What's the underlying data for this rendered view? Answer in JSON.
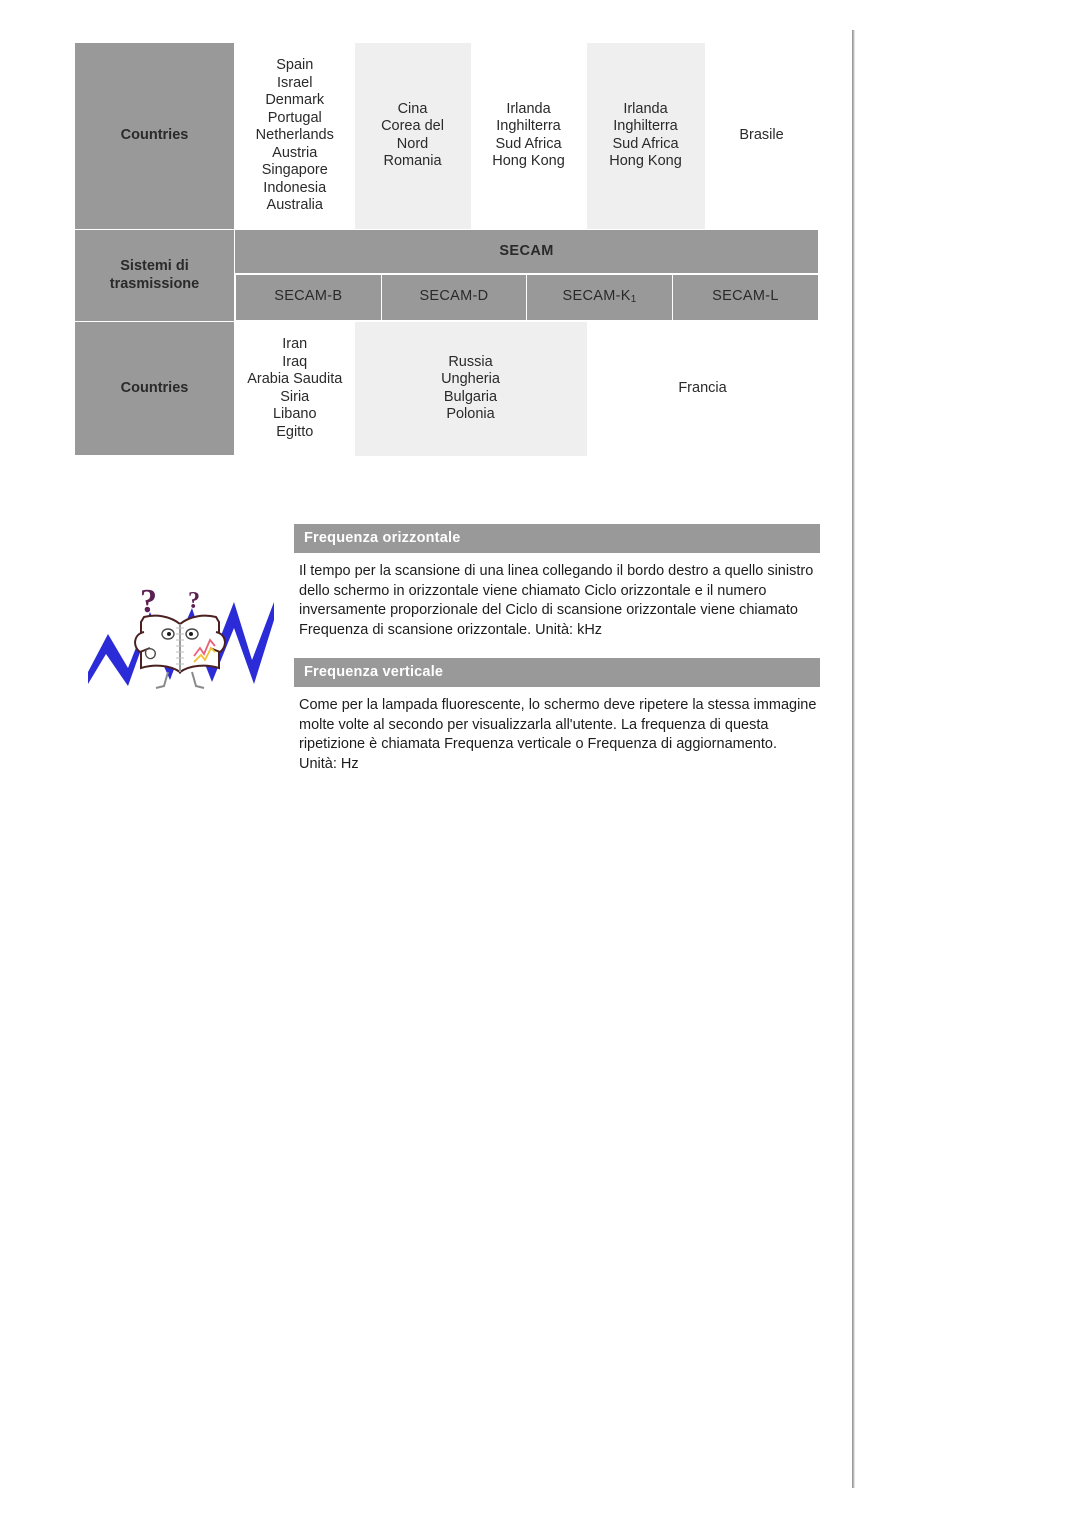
{
  "broadcast_table": {
    "row_countries_top": {
      "header": "Countries",
      "cells": [
        "Spain\nIsrael\nDenmark\nPortugal\nNetherlands\nAustria\nSingapore\nIndonesia\nAustralia",
        "Cina\nCorea del\nNord\nRomania",
        "Irlanda\nInghilterra\nSud Africa\nHong Kong",
        "Irlanda\nInghilterra\nSud Africa\nHong Kong",
        "Brasile"
      ]
    },
    "row_systems": {
      "header": "Sistemi di\ntrasmissione",
      "group_label": "SECAM",
      "systems": [
        {
          "label": "SECAM-B",
          "sub": ""
        },
        {
          "label": "SECAM-D",
          "sub": ""
        },
        {
          "label": "SECAM-K",
          "sub": "1"
        },
        {
          "label": "SECAM-L",
          "sub": ""
        }
      ]
    },
    "row_countries_bottom": {
      "header": "Countries",
      "cells": [
        "Iran\nIraq\nArabia Saudita\nSiria\nLibano\nEgitto",
        "Russia\nUngheria\nBulgaria\nPolonia",
        "Francia"
      ]
    }
  },
  "definitions": [
    {
      "title": "Frequenza orizzontale",
      "body": "Il tempo per la scansione di una linea collegando il bordo destro a quello sinistro dello schermo in orizzontale viene chiamato Ciclo orizzontale e il numero inversamente proporzionale del Ciclo di scansione orizzontale viene chiamato Frequenza di scansione orizzontale. Unità: kHz"
    },
    {
      "title": "Frequenza verticale",
      "body": "Come per la lampada fluorescente, lo schermo deve ripetere la stessa immagine molte volte al secondo per visualizzarla all'utente. La frequenza di questa ripetizione è chiamata Frequenza verticale o Frequenza di aggiornamento. Unità: Hz"
    }
  ],
  "illustration": {
    "name": "book-with-question-marks-illustration"
  },
  "colors": {
    "header_gray": "#999999",
    "shade_gray": "#efefef",
    "text_dark": "#1d1d1d",
    "accent_blue": "#2b2bd8"
  }
}
